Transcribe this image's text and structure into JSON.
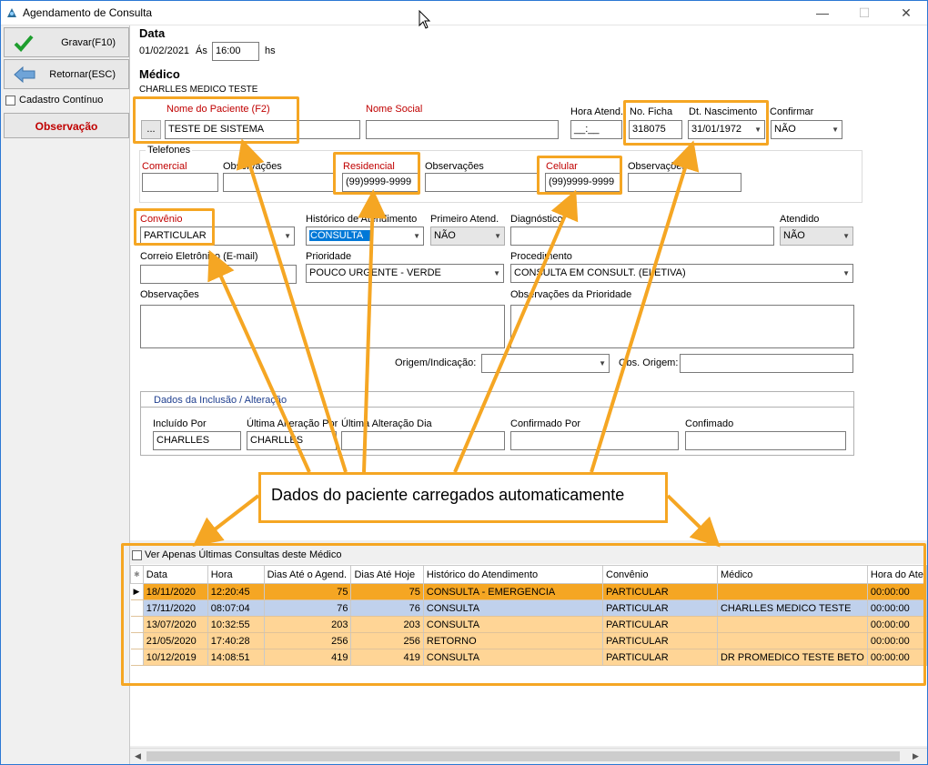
{
  "window": {
    "title": "Agendamento de Consulta",
    "min": "—",
    "max": "☐",
    "close": "✕"
  },
  "sidebar": {
    "save_label": "Gravar(F10)",
    "back_label": "Retornar(ESC)",
    "continuous_label": "Cadastro Contínuo",
    "obs_label": "Observação"
  },
  "header": {
    "date_title": "Data",
    "date_value": "01/02/2021",
    "at_label": "Ás",
    "time_value": "16:00",
    "hs_label": "hs",
    "medico_title": "Médico",
    "medico_value": "CHARLLES MEDICO TESTE"
  },
  "patient": {
    "name_label": "Nome do Paciente (F2)",
    "lookup_label": "...",
    "name_value": "TESTE DE SISTEMA",
    "social_label": "Nome Social",
    "social_value": "",
    "hora_label": "Hora Atend.",
    "hora_value": "__:__",
    "ficha_label": "No. Ficha",
    "ficha_value": "318075",
    "nasc_label": "Dt. Nascimento",
    "nasc_value": "31/01/1972",
    "confirmar_label": "Confirmar",
    "confirmar_value": "NÃO"
  },
  "phones": {
    "title": "Telefones",
    "comercial_label": "Comercial",
    "comercial_value": "",
    "obs1_label": "Observações",
    "residencial_label": "Residencial",
    "residencial_value": "(99)9999-9999",
    "obs2_label": "Observações",
    "celular_label": "Celular",
    "celular_value": "(99)9999-9999",
    "obs3_label": "Observações"
  },
  "details": {
    "convenio_label": "Convênio",
    "convenio_value": "PARTICULAR",
    "historico_label": "Histórico de Atendimento",
    "historico_value": "CONSULTA",
    "primeiro_label": "Primeiro Atend.",
    "primeiro_value": "NÃO",
    "diagnostico_label": "Diagnóstico",
    "atendido_label": "Atendido",
    "atendido_value": "NÃO",
    "email_label": "Correio Eletrônico (E-mail)",
    "prioridade_label": "Prioridade",
    "prioridade_value": "POUCO URGENTE - VERDE",
    "procedimento_label": "Procedimento",
    "procedimento_value": "CONSULTA EM CONSULT. (ELETIVA)",
    "obs_label": "Observações",
    "obs_prior_label": "Observações da Prioridade",
    "origem_label": "Origem/Indicação:",
    "obs_origem_label": "Obs. Origem:"
  },
  "audit": {
    "title": "Dados da Inclusão / Alteração",
    "incluido_label": "Incluído Por",
    "incluido_value": "CHARLLES",
    "ult_alt_label": "Última Alteração Por",
    "ult_alt_value": "CHARLLES",
    "ult_dia_label": "Última Alteração Dia",
    "confirmado_por_label": "Confirmado Por",
    "confirmado_label": "Confimado"
  },
  "callout": "Dados do paciente carregados automaticamente",
  "history": {
    "filter_label": "Ver Apenas Últimas Consultas deste Médico",
    "columns": [
      "Data",
      "Hora",
      "Dias Até o Agend.",
      "Dias Até Hoje",
      "Histórico do Atendimento",
      "Convênio",
      "Médico",
      "Hora do Ate"
    ],
    "rows": [
      [
        "18/11/2020",
        "12:20:45",
        "75",
        "75",
        "CONSULTA - EMERGENCIA",
        "PARTICULAR",
        "",
        "00:00:00"
      ],
      [
        "17/11/2020",
        "08:07:04",
        "76",
        "76",
        "CONSULTA",
        "PARTICULAR",
        "CHARLLES MEDICO TESTE",
        "00:00:00"
      ],
      [
        "13/07/2020",
        "10:32:55",
        "203",
        "203",
        "CONSULTA",
        "PARTICULAR",
        "",
        "00:00:00"
      ],
      [
        "21/05/2020",
        "17:40:28",
        "256",
        "256",
        "RETORNO",
        "PARTICULAR",
        "",
        "00:00:00"
      ],
      [
        "10/12/2019",
        "14:08:51",
        "419",
        "419",
        "CONSULTA",
        "PARTICULAR",
        "DR PROMEDICO TESTE BETO",
        "00:00:00"
      ]
    ]
  },
  "colors": {
    "accent": "#f5a623",
    "label_red": "#c00000",
    "selection_blue": "#0078d7"
  }
}
